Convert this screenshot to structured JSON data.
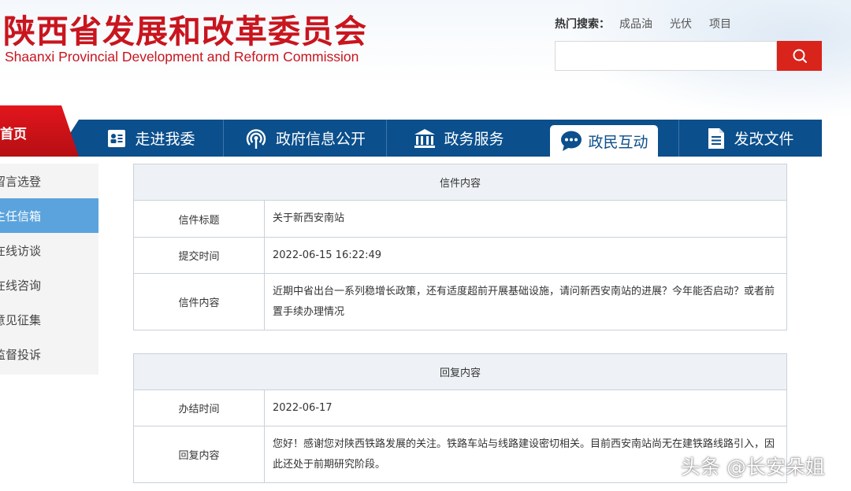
{
  "header": {
    "title_cn": "陕西省发展和改革委员会",
    "title_en": "Shaanxi Provincial Development and Reform Commission",
    "hot_search_label": "热门搜索：",
    "hot_search_items": [
      "成品油",
      "光伏",
      "项目"
    ],
    "search_value": ""
  },
  "nav": {
    "home": "首页",
    "items": [
      {
        "label": "走进我委",
        "icon": "id-card-icon"
      },
      {
        "label": "政府信息公开",
        "icon": "broadcast-icon"
      },
      {
        "label": "政务服务",
        "icon": "government-building-icon"
      },
      {
        "label": "政民互动",
        "icon": "chat-bubble-icon",
        "active": true
      },
      {
        "label": "发改文件",
        "icon": "document-icon"
      }
    ]
  },
  "sidebar": {
    "items": [
      {
        "label": "留言选登"
      },
      {
        "label": "主任信箱",
        "active": true
      },
      {
        "label": "在线访谈"
      },
      {
        "label": "在线咨询"
      },
      {
        "label": "意见征集"
      },
      {
        "label": "监督投诉"
      }
    ]
  },
  "letter": {
    "header": "信件内容",
    "rows": [
      {
        "label": "信件标题",
        "value": "关于新西安南站"
      },
      {
        "label": "提交时间",
        "value": "2022-06-15 16:22:49"
      },
      {
        "label": "信件内容",
        "value": "近期中省出台一系列稳增长政策，还有适度超前开展基础设施，请问新西安南站的进展？今年能否启动？或者前置手续办理情况"
      }
    ]
  },
  "reply": {
    "header": "回复内容",
    "rows": [
      {
        "label": "办结时间",
        "value": "2022-06-17"
      },
      {
        "label": "回复内容",
        "value": "您好！感谢您对陕西铁路发展的关注。铁路车站与线路建设密切相关。目前西安南站尚无在建铁路线路引入，因此还处于前期研究阶段。"
      }
    ]
  },
  "watermark": "头条 @长安朵姐",
  "colors": {
    "brand_red": "#c9151e",
    "nav_blue": "#0b4f8c",
    "sidebar_active": "#5ba3dc"
  }
}
